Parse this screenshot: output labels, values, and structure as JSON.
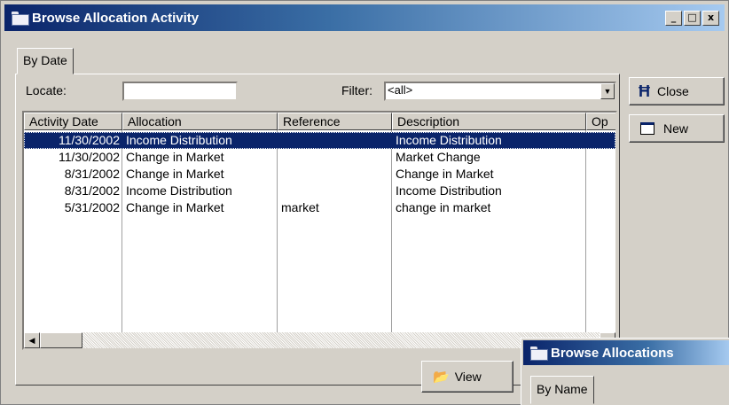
{
  "window": {
    "title": "Browse Allocation Activity",
    "icon": "folder-icon",
    "controls": {
      "minimize": "_",
      "maximize": "□",
      "close": "x"
    }
  },
  "tabs": [
    "By Date"
  ],
  "locate": {
    "label": "Locate:",
    "value": ""
  },
  "filter": {
    "label": "Filter:",
    "value": "<all>"
  },
  "table": {
    "columns": [
      "Activity Date",
      "Allocation",
      "Reference",
      "Description",
      "Op"
    ],
    "rows": [
      {
        "date": "11/30/2002",
        "allocation": "Income Distribution",
        "reference": "",
        "description": "Income Distribution"
      },
      {
        "date": "11/30/2002",
        "allocation": "Change in Market",
        "reference": "",
        "description": "Market Change"
      },
      {
        "date": "8/31/2002",
        "allocation": "Change in Market",
        "reference": "",
        "description": "Change in Market"
      },
      {
        "date": "8/31/2002",
        "allocation": "Income Distribution",
        "reference": "",
        "description": "Income Distribution"
      },
      {
        "date": "5/31/2002",
        "allocation": "Change in Market",
        "reference": "market",
        "description": "change in market"
      }
    ],
    "selected_row": 0
  },
  "buttons": {
    "close": "Close",
    "new": "New",
    "view": "View"
  },
  "popup": {
    "title": "Browse Allocations",
    "tab": "By Name"
  },
  "colors": {
    "titlebar": "#0a246a",
    "selection": "#0a246a",
    "face": "#d4d0c8"
  }
}
